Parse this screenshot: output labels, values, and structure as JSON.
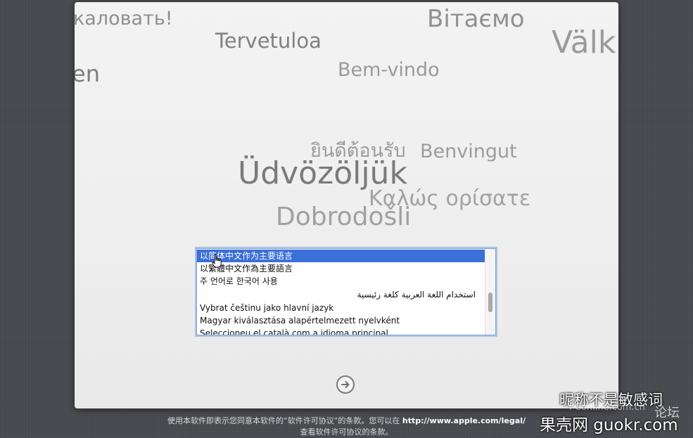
{
  "welcome_words": [
    {
      "text": "каловать!",
      "size": 27
    },
    {
      "text": "Tervetuloa",
      "size": 29
    },
    {
      "text": "Вітаємо",
      "size": 34
    },
    {
      "text": "Välk",
      "size": 44
    },
    {
      "text": "en",
      "size": 32
    },
    {
      "text": "Bem-vindo",
      "size": 27
    },
    {
      "text": "ยินดีต้อนรับ",
      "size": 27
    },
    {
      "text": "Benvingut",
      "size": 27
    },
    {
      "text": "Üdvözöljük",
      "size": 44
    },
    {
      "text": "Καλώς ορίσατε",
      "size": 30
    },
    {
      "text": "Dobrodošli",
      "size": 36
    }
  ],
  "language_list": {
    "items": [
      "以简体中文作为主要语言",
      "以繁體中文作為主要語言",
      "주 언어로 한국어 사용",
      "استخدام اللغة العربية كلغة رئيسية",
      "Vybrat češtinu jako hlavní jazyk",
      "Magyar kiválasztása alapértelmezett nyelvként",
      "Seleccioneu el català com a idioma principal"
    ],
    "selected_index": 0,
    "selection_color": "#3a6fd8"
  },
  "continue_button": {
    "icon": "right-arrow-circle-icon"
  },
  "footer": {
    "line1_prefix": "使用本软件即表示您同意本软件的“软件许可协议”的条款。您可以在",
    "line1_url": "http://www.apple.com/legal/",
    "line2": "查看软件许可协议的条款。"
  },
  "watermarks": {
    "nickname": "昵称不是敏感词",
    "pconline": "PConline.com.cn",
    "forum": "论坛",
    "guokr": "果壳网 guokr.com"
  }
}
